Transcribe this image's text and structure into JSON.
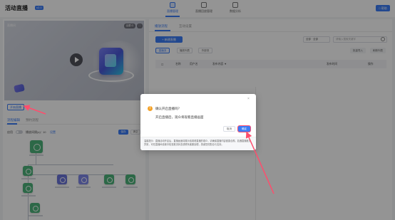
{
  "header": {
    "title": "活动直播",
    "badge": "v2.0",
    "help_label": "□ 帮助",
    "nav": [
      {
        "label": "直播管理",
        "active": true
      },
      {
        "label": "直播回放管理",
        "active": false
      },
      {
        "label": "数据分析",
        "active": false
      }
    ]
  },
  "preview": {
    "label": "直播间",
    "controls": [
      "全屏 ⊡",
      "⛶"
    ]
  },
  "left_panel": {
    "start_button": "开始直播",
    "tabs": [
      "流程编辑",
      "预约流程"
    ],
    "flow_toolbar": {
      "toggle_label": "启用",
      "interval_label": "播放间隔(s)：",
      "interval_value": "10",
      "link_label": "设置",
      "save_label": "保存",
      "reset_label": "清空"
    }
  },
  "right_panel": {
    "tabs": [
      "播放流程",
      "互动设置"
    ],
    "create_button": "+ 新建直播",
    "filters": [
      "全部 · 全部",
      "请输入搜索关键字"
    ],
    "chips": [
      "直播流",
      "播放列表",
      "外部流"
    ],
    "action_buttons": [
      "批量导入",
      "刷新列表"
    ],
    "table_headers": [
      "名称",
      "用户名",
      "发布内容 ▼",
      "发布时间",
      "操作"
    ]
  },
  "dialog": {
    "title": "确认开启直播吗？",
    "message": "开启直播后，观众将观看直播画面",
    "cancel": "取消",
    "confirm": "确定",
    "close_icon": "×",
    "warn_icon": "!",
    "note": "温馨提示：直播活动开启后，直播画面将展示给观看直播的观众，请确保直播内容健康合规。如遇直播推流异常，可在直播间设置中检查推流状态或联系客服处理，感谢您的配合与支持。"
  },
  "colors": {
    "accent": "#3b7cf6",
    "node_green": "#4cb47a",
    "node_purple": "#6a74da",
    "annotation": "#ff4d6d"
  }
}
